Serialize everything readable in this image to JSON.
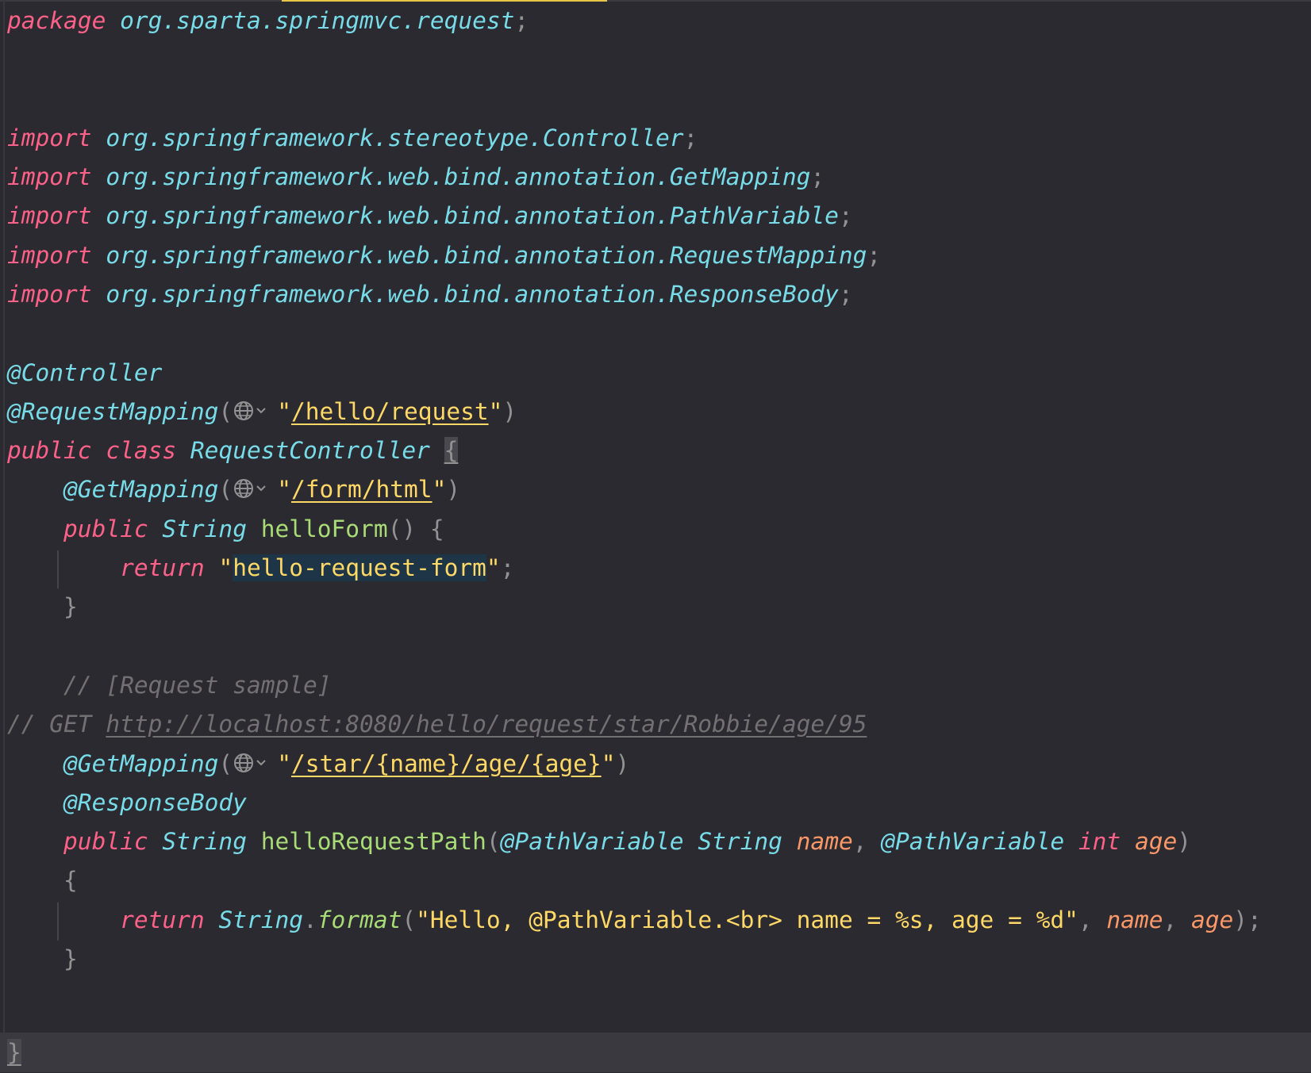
{
  "code": {
    "l1": {
      "kw": "package",
      "pkg": "org.sparta.springmvc.request",
      "semi": ";"
    },
    "imports": [
      {
        "kw": "import",
        "pkg": "org.springframework.stereotype.Controller",
        "semi": ";"
      },
      {
        "kw": "import",
        "pkg": "org.springframework.web.bind.annotation.GetMapping",
        "semi": ";"
      },
      {
        "kw": "import",
        "pkg": "org.springframework.web.bind.annotation.PathVariable",
        "semi": ";"
      },
      {
        "kw": "import",
        "pkg": "org.springframework.web.bind.annotation.RequestMapping",
        "semi": ";"
      },
      {
        "kw": "import",
        "pkg": "org.springframework.web.bind.annotation.ResponseBody",
        "semi": ";"
      }
    ],
    "ann_controller": "@Controller",
    "ann_reqmap": {
      "name": "@RequestMapping",
      "open": "(",
      "q1": "\"",
      "path": "/hello/request",
      "q2": "\"",
      "close": ")"
    },
    "class_decl": {
      "kw1": "public",
      "kw2": "class",
      "name": "RequestController",
      "brace": "{"
    },
    "get1": {
      "name": "@GetMapping",
      "open": "(",
      "q1": "\"",
      "path": "/form/html",
      "q2": "\"",
      "close": ")"
    },
    "method1": {
      "kw": "public",
      "type": "String",
      "name": "helloForm",
      "parens": "()",
      "brace": "{"
    },
    "return1": {
      "kw": "return",
      "q1": "\"",
      "str": "hello-request-form",
      "q2": "\"",
      "semi": ";"
    },
    "close1": "}",
    "comment1": "// [Request sample]",
    "comment2": {
      "prefix": "// GET ",
      "url": "http://localhost:8080/hello/request/star/Robbie/age/95"
    },
    "get2": {
      "name": "@GetMapping",
      "open": "(",
      "q1": "\"",
      "path": "/star/{name}/age/{age}",
      "q2": "\"",
      "close": ")"
    },
    "ann_respbody": "@ResponseBody",
    "method2": {
      "kw": "public",
      "type": "String",
      "name": "helloRequestPath",
      "open": "(",
      "ann1": "@PathVariable",
      "t1": "String",
      "p1": "name",
      "comma": ",",
      "ann2": "@PathVariable",
      "t2": "int",
      "p2": "age",
      "close": ")"
    },
    "open2": "{",
    "return2": {
      "kw": "return",
      "type": "String",
      "dot": ".",
      "fn": "format",
      "open": "(",
      "str": "\"Hello, @PathVariable.<br> name = %s, age = %d\"",
      "comma1": ",",
      "a1": "name",
      "comma2": ",",
      "a2": "age",
      "close": ");"
    },
    "close2": "}",
    "close_class": "}"
  },
  "icons": {
    "inlay": "globe-dropdown-icon"
  },
  "colors": {
    "background": "#2b2a30",
    "keyword": "#ff6188",
    "type": "#78dce8",
    "function": "#a9dc76",
    "string": "#ffd866",
    "parameter": "#fc9867",
    "comment": "#727072"
  }
}
